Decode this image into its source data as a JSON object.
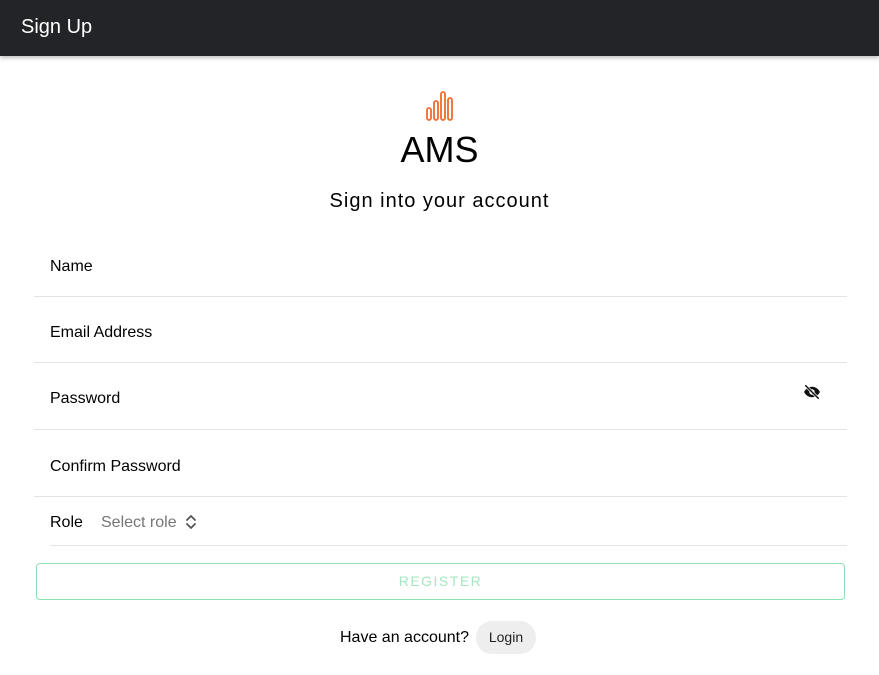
{
  "toolbar": {
    "title": "Sign Up"
  },
  "brand": {
    "logo_icon": "bar-chart-icon",
    "logo_color": "#f26a2d",
    "app_name": "AMS",
    "subtitle": "Sign into your account"
  },
  "form": {
    "name_label": "Name",
    "email_label": "Email Address",
    "password_label": "Password",
    "password_toggle_icon": "eye-off-icon",
    "confirm_password_label": "Confirm Password",
    "role_label": "Role",
    "role_placeholder": "Select role",
    "role_select_icon": "chevron-up-down-icon",
    "register_label": "REGISTER"
  },
  "footer": {
    "prompt": "Have an account?",
    "login_label": "Login"
  },
  "colors": {
    "toolbar_bg": "#222428",
    "accent": "#f26a2d",
    "register_border": "#8fdfb0",
    "register_text": "#a6e7c1"
  }
}
